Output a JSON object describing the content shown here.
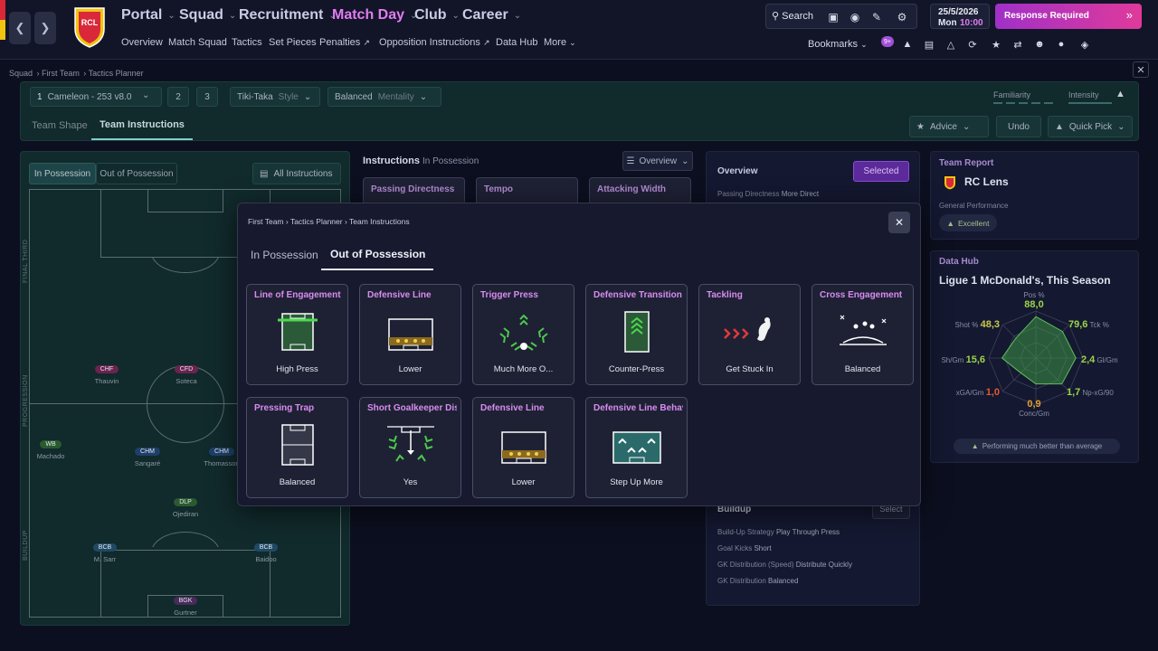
{
  "colors": {
    "accent": "#e07cf0",
    "brand_red": "#d8283a",
    "brand_yellow": "#f1c40f",
    "pitch": "#112a2c",
    "response": "#d23bbf"
  },
  "nav": {
    "menus": [
      {
        "label": "Portal"
      },
      {
        "label": "Squad"
      },
      {
        "label": "Recruitment"
      },
      {
        "label": "Match Day",
        "active": true
      },
      {
        "label": "Club"
      },
      {
        "label": "Career"
      }
    ],
    "sublinks": [
      "Overview",
      "Match Squad",
      "Tactics",
      "Set Pieces",
      "Penalties",
      "Opposition Instructions",
      "Data Hub",
      "More"
    ],
    "search_label": "Search",
    "date": "25/5/2026",
    "day": "Mon",
    "time": "10:00",
    "response_label": "Response Required",
    "bookmarks_label": "Bookmarks",
    "notification_count": "9+",
    "club_badge_text": "RCL"
  },
  "breadcrumb": [
    "Squad",
    "First Team",
    "Tactics Planner"
  ],
  "tactics": {
    "slot_number": "1",
    "formation": "Cameleon - 253 v8.0",
    "slot2": "2",
    "slot3": "3",
    "style_value": "Tiki-Taka",
    "style_label": "Style",
    "mentality_value": "Balanced",
    "mentality_label": "Mentality",
    "familiarity_label": "Familiarity",
    "intensity_label": "Intensity",
    "tabs": [
      "Team Shape",
      "Team Instructions"
    ],
    "advice_label": "Advice",
    "undo_label": "Undo",
    "quick_pick_label": "Quick Pick"
  },
  "pitch": {
    "tabs": [
      "In Possession",
      "Out of Possession"
    ],
    "all_instructions": "All Instructions",
    "zones": [
      "FINAL THIRD",
      "PROGRESSION",
      "BUILDUP"
    ],
    "players": [
      {
        "pos": "CHF",
        "name": "Thauvin",
        "color": "#6b2350"
      },
      {
        "pos": "CFD",
        "name": "Soteca",
        "color": "#6b2350"
      },
      {
        "pos": "WB",
        "name": "Machado",
        "color": "#2a5a30"
      },
      {
        "pos": "CHM",
        "name": "Sangaré",
        "color": "#1f3f6a"
      },
      {
        "pos": "CHM",
        "name": "Thomasson",
        "color": "#1f3f6a"
      },
      {
        "pos": "DLP",
        "name": "Ojediran",
        "color": "#2a5a30"
      },
      {
        "pos": "BCB",
        "name": "M. Sarr",
        "color": "#1f4a66"
      },
      {
        "pos": "BCB",
        "name": "Baidoo",
        "color": "#1f4a66"
      },
      {
        "pos": "BGK",
        "name": "Gurtner",
        "color": "#4a2a5a"
      }
    ]
  },
  "instructions_panel": {
    "title": "Instructions",
    "sub": "In Possession",
    "overview_label": "Overview",
    "cards": [
      "Passing Directness",
      "Tempo",
      "Attacking Width"
    ]
  },
  "overview_panel": {
    "title": "Overview",
    "selected_label": "Selected",
    "line1_label": "Passing Directness",
    "line1_value": "More Direct",
    "buildup_title": "Buildup",
    "select_label": "Select",
    "buildup_lines": [
      {
        "label": "Build-Up Strategy",
        "value": "Play Through Press"
      },
      {
        "label": "Goal Kicks",
        "value": "Short"
      },
      {
        "label": "GK Distribution (Speed)",
        "value": "Distribute Quickly"
      },
      {
        "label": "GK Distribution",
        "value": "Balanced"
      }
    ]
  },
  "team_report": {
    "title": "Team Report",
    "club": "RC Lens",
    "perf_label": "General Performance",
    "perf_value": "Excellent"
  },
  "data_hub": {
    "title": "Data Hub",
    "subtitle": "Ligue 1 McDonald's, This Season",
    "footer": "Performing much better than average",
    "metrics": [
      {
        "label": "Pos %",
        "value": "88,0",
        "color": "#9bd44a"
      },
      {
        "label": "Tck %",
        "value": "79,6",
        "color": "#9bd44a"
      },
      {
        "label": "Gl/Gm",
        "value": "2,4",
        "color": "#9bd44a"
      },
      {
        "label": "Np-xG/90",
        "value": "1,7",
        "color": "#9bd44a"
      },
      {
        "label": "Conc/Gm",
        "value": "0,9",
        "color": "#e0a030"
      },
      {
        "label": "xGA/Gm",
        "value": "1,0",
        "color": "#e05a30"
      },
      {
        "label": "Sh/Gm",
        "value": "15,6",
        "color": "#9bd44a"
      },
      {
        "label": "Shot %",
        "value": "48,3",
        "color": "#c8c84a"
      }
    ],
    "radar_levels": [
      0.88,
      0.8,
      0.85,
      0.78,
      0.55,
      0.45,
      0.72,
      0.6
    ]
  },
  "modal": {
    "breadcrumb": [
      "First Team",
      "Tactics Planner",
      "Team Instructions"
    ],
    "tabs": [
      "In Possession",
      "Out of Possession"
    ],
    "cards": [
      {
        "title": "Line of Engagement",
        "value": "High Press",
        "icon": "line-of-engagement-icon"
      },
      {
        "title": "Defensive Line",
        "value": "Lower",
        "icon": "defensive-line-icon"
      },
      {
        "title": "Trigger Press",
        "value": "Much More O...",
        "icon": "trigger-press-icon"
      },
      {
        "title": "Defensive Transition",
        "value": "Counter-Press",
        "icon": "defensive-transition-icon"
      },
      {
        "title": "Tackling",
        "value": "Get Stuck In",
        "icon": "tackling-icon"
      },
      {
        "title": "Cross Engagement",
        "value": "Balanced",
        "icon": "cross-engagement-icon"
      },
      {
        "title": "Pressing Trap",
        "value": "Balanced",
        "icon": "pressing-trap-icon"
      },
      {
        "title": "Short Goalkeeper Distribution",
        "value": "Yes",
        "icon": "short-gk-distribution-icon"
      },
      {
        "title": "Defensive Line",
        "value": "Lower",
        "icon": "defensive-line-icon"
      },
      {
        "title": "Defensive Line Behaviour",
        "value": "Step Up More",
        "icon": "defensive-line-behaviour-icon"
      }
    ]
  }
}
